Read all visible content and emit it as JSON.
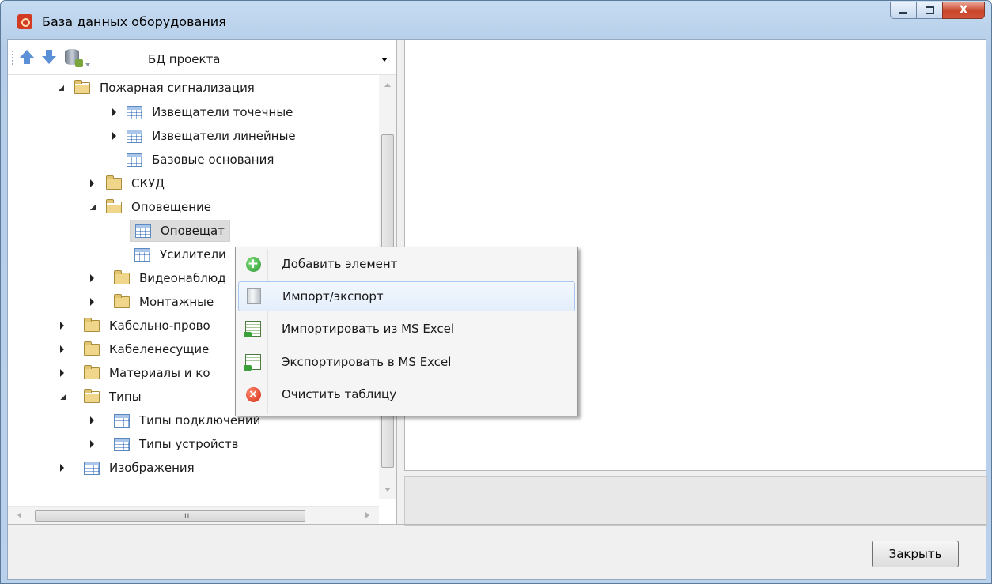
{
  "window": {
    "title": "База данных оборудования",
    "icons": {
      "app": "app-red-icon",
      "minimize": "minimize-icon",
      "maximize": "maximize-icon",
      "close": "close-icon"
    },
    "close_glyph": "X"
  },
  "toolbar": {
    "move_up_icon": "arrow-up-icon",
    "move_down_icon": "arrow-down-icon",
    "database_icon": "database-settings-icon",
    "db_select": {
      "value": "БД проекта"
    }
  },
  "tree": {
    "items": [
      {
        "label": "Пожарная сигнализация",
        "icon": "folder-open-icon",
        "state": "expanded"
      },
      {
        "label": "Извещатели точечные",
        "icon": "table-icon",
        "state": "collapsed"
      },
      {
        "label": "Извещатели линейные",
        "icon": "table-icon",
        "state": "collapsed"
      },
      {
        "label": "Базовые основания",
        "icon": "table-icon",
        "state": "leaf"
      },
      {
        "label": "СКУД",
        "icon": "folder-icon",
        "state": "collapsed"
      },
      {
        "label": "Оповещение",
        "icon": "folder-open-icon",
        "state": "expanded"
      },
      {
        "label": "Оповещат",
        "icon": "table-icon",
        "state": "leaf",
        "selected": true
      },
      {
        "label": "Усилители",
        "icon": "table-icon",
        "state": "leaf"
      },
      {
        "label": "Видеонаблюд",
        "icon": "folder-icon",
        "state": "collapsed"
      },
      {
        "label": "Монтажные",
        "icon": "folder-icon",
        "state": "collapsed"
      },
      {
        "label": "Кабельно-прово",
        "icon": "folder-icon",
        "state": "collapsed"
      },
      {
        "label": "Кабеленесущие",
        "icon": "folder-icon",
        "state": "collapsed"
      },
      {
        "label": "Материалы и ко",
        "icon": "folder-icon",
        "state": "collapsed"
      },
      {
        "label": "Типы",
        "icon": "folder-open-icon",
        "state": "expanded"
      },
      {
        "label": "Типы подключений",
        "icon": "table-icon",
        "state": "collapsed"
      },
      {
        "label": "Типы устройств",
        "icon": "table-icon",
        "state": "collapsed"
      },
      {
        "label": "Изображения",
        "icon": "table-icon",
        "state": "collapsed"
      }
    ],
    "hscroll_grip": "III"
  },
  "context_menu": {
    "items": [
      {
        "label": "Добавить элемент",
        "icon": "add-green-icon"
      },
      {
        "label": "Импорт/экспорт",
        "icon": "document-icon",
        "hover": true
      },
      {
        "label": "Импортировать из MS Excel",
        "icon": "excel-import-icon"
      },
      {
        "label": "Экспортировать в MS Excel",
        "icon": "excel-export-icon"
      },
      {
        "label": "Очистить таблицу",
        "icon": "clear-red-icon"
      }
    ]
  },
  "footer": {
    "close_button": "Закрыть"
  }
}
